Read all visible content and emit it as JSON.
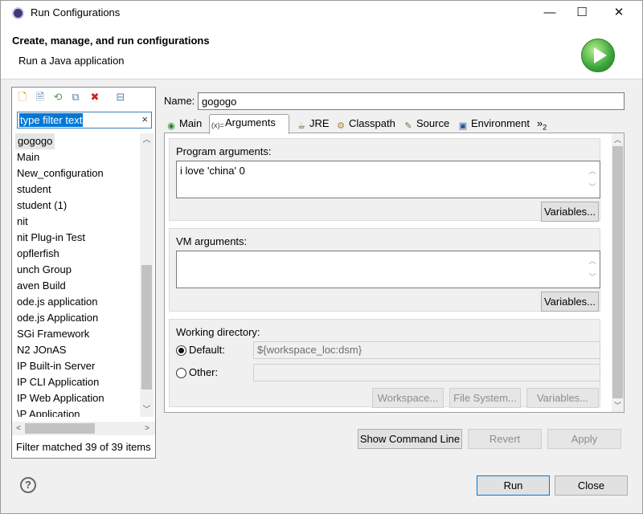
{
  "window": {
    "title": "Run Configurations",
    "minimize": "—",
    "maximize": "☐",
    "close": "✕"
  },
  "header": {
    "title": "Create, manage, and run configurations",
    "subtitle": "Run a Java application"
  },
  "left": {
    "filter_placeholder": "type filter text",
    "filter_clear": "×",
    "items": [
      "gogogo",
      "Main",
      "New_configuration",
      "student",
      "student (1)",
      "nit",
      "nit Plug-in Test",
      "opflerfish",
      "unch Group",
      "aven Build",
      "ode.js application",
      "ode.js Application",
      "SGi Framework",
      "N2 JOnAS",
      "IP Built-in Server",
      "IP CLI Application",
      "IP Web Application",
      "\\P Application"
    ],
    "selected_index": 0,
    "status": "Filter matched 39 of 39 items"
  },
  "name": {
    "label": "Name:",
    "value": "gogogo"
  },
  "tabs": [
    {
      "label": "Main",
      "icon": "main-tab-icon"
    },
    {
      "label": "Arguments",
      "icon": "arguments-tab-icon"
    },
    {
      "label": "JRE",
      "icon": "jre-tab-icon"
    },
    {
      "label": "Classpath",
      "icon": "classpath-tab-icon"
    },
    {
      "label": "Source",
      "icon": "source-tab-icon"
    },
    {
      "label": "Environment",
      "icon": "environment-tab-icon"
    }
  ],
  "tabs_overflow": "»",
  "tabs_overflow_count": "2",
  "arguments": {
    "program_label": "Program arguments:",
    "program_value": "i love 'china' 0",
    "vm_label": "VM arguments:",
    "vm_value": "",
    "variables": "Variables...",
    "working_dir_label": "Working directory:",
    "default_label": "Default:",
    "default_value": "${workspace_loc:dsm}",
    "other_label": "Other:",
    "other_value": "",
    "workspace_btn": "Workspace...",
    "filesystem_btn": "File System...",
    "variables_btn": "Variables..."
  },
  "actions": {
    "show_command_line": "Show Command Line",
    "revert": "Revert",
    "apply": "Apply",
    "run": "Run",
    "close": "Close"
  },
  "help": "?",
  "colors": {
    "accent": "#0078d7",
    "selection": "#e5e5e5"
  }
}
